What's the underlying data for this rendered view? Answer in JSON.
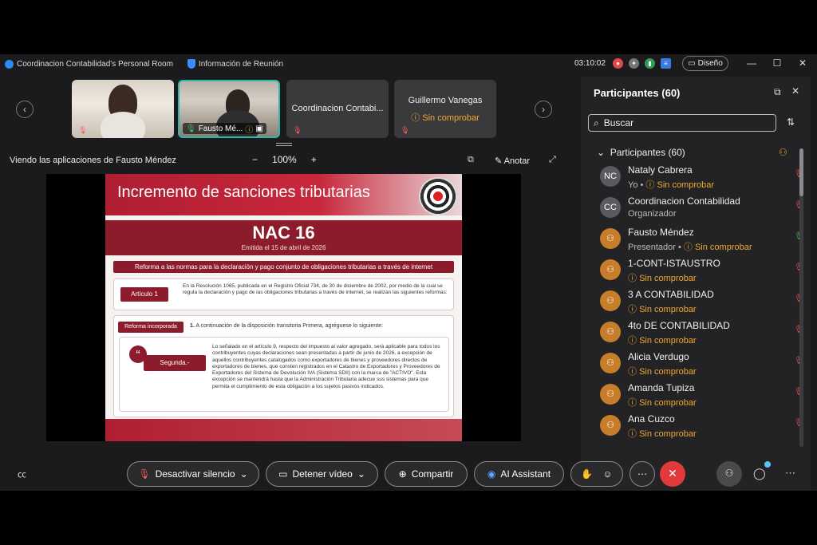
{
  "window": {
    "room_title": "Coordinacion Contabilidad's Personal Room",
    "meeting_info": "Información de Reunión",
    "timer": "03:10:02",
    "layout_label": "Diseño"
  },
  "thumbnails": [
    {
      "name": "",
      "status": ""
    },
    {
      "name": "Fausto Mé...",
      "status": ""
    },
    {
      "name": "Coordinacion Contabi...",
      "status": ""
    },
    {
      "name": "Guillermo Vanegas",
      "status": "Sin comprobar"
    }
  ],
  "viewer": {
    "viewing_text": "Viendo las aplicaciones de Fausto Méndez",
    "zoom": "100%",
    "annotate": "Anotar"
  },
  "slide": {
    "title": "Incremento de sanciones tributarias",
    "nac": "NAC 16",
    "emitida": "Emitida el 15 de abril de 2026",
    "ribbon": "Reforma a las normas para la declaración y pago conjunto de obligaciones tributarias a través de internet",
    "articulo_label": "Artículo 1",
    "articulo_text": "En la Resolución 1065, publicada en el Registro Oficial 734, de 30 de diciembre de 2002, por medio de la cual se regula la declaración y pago de las obligaciones tributarias a través de internet, se realizan las siguientes reformas:",
    "reforma_label": "Reforma incorporada",
    "reforma_num": "1.",
    "reforma_text": "A continuación de la disposición transitoria Primera, agréguese lo siguiente:",
    "segunda_label": "Segunda.-",
    "segunda_text": "Lo señalado en el artículo 9, respecto del impuesto al valor agregado, será aplicable para todos los contribuyentes cuyas declaraciones sean presentadas a partir de junio de 2026, a excepción de aquellos contribuyentes catalogados como exportadores de bienes y proveedores directos de exportadores de bienes, que consten registrados en el Catastro de Exportadores y Proveedores de Exportadores del Sistema de Devolución IVA (Sistema SDII) con la marca de \"ACTIVO\". Esta excepción se mantendrá hasta que la Administración Tributaria adecue sus sistemas para que permita el cumplimiento de esta obligación a los sujetos pasivos indicados."
  },
  "participants_panel": {
    "title": "Participantes (60)",
    "search_placeholder": "Buscar",
    "section": "Participantes (60)",
    "people": [
      {
        "initials": "NC",
        "name": "Nataly Cabrera",
        "role": "Yo",
        "status": "Sin comprobar",
        "avatar": "grey",
        "mic": "off"
      },
      {
        "initials": "CC",
        "name": "Coordinacion Contabilidad",
        "role": "Organizador",
        "status": "",
        "avatar": "grey",
        "mic": "off"
      },
      {
        "initials": "",
        "name": "Fausto Méndez",
        "role": "Presentador",
        "status": "Sin comprobar",
        "avatar": "orange",
        "mic": "on"
      },
      {
        "initials": "",
        "name": "1-CONT-ISTAUSTRO",
        "role": "",
        "status": "Sin comprobar",
        "avatar": "orange",
        "mic": "off"
      },
      {
        "initials": "",
        "name": "3 A CONTABILIDAD",
        "role": "",
        "status": "Sin comprobar",
        "avatar": "orange",
        "mic": "off"
      },
      {
        "initials": "",
        "name": "4to DE CONTABILIDAD",
        "role": "",
        "status": "Sin comprobar",
        "avatar": "orange",
        "mic": "off"
      },
      {
        "initials": "",
        "name": "Alicia Verdugo",
        "role": "",
        "status": "Sin comprobar",
        "avatar": "orange",
        "mic": "off"
      },
      {
        "initials": "",
        "name": "Amanda Tupiza",
        "role": "",
        "status": "Sin comprobar",
        "avatar": "orange",
        "mic": "off"
      },
      {
        "initials": "",
        "name": "Ana Cuzco",
        "role": "",
        "status": "Sin comprobar",
        "avatar": "orange",
        "mic": "off"
      }
    ]
  },
  "controls": {
    "mute": "Desactivar silencio",
    "video": "Detener vídeo",
    "share": "Compartir",
    "ai": "AI Assistant"
  },
  "colors": {
    "accent_teal": "#2fb8a8",
    "mute_red": "#ff5a5a",
    "status_orange": "#f0a830",
    "slide_red": "#8c1b2c",
    "end_red": "#e23a3a"
  }
}
